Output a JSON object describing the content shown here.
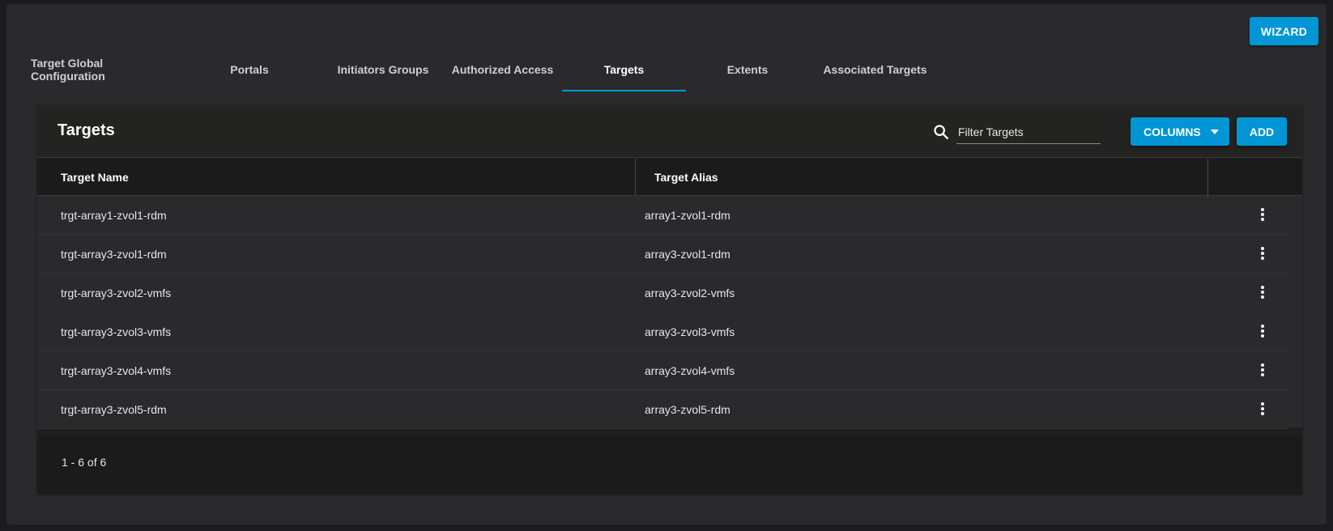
{
  "toolbar": {
    "wizard_label": "WIZARD"
  },
  "tabs": [
    {
      "label": "Target Global Configuration",
      "active": false
    },
    {
      "label": "Portals",
      "active": false
    },
    {
      "label": "Initiators Groups",
      "active": false
    },
    {
      "label": "Authorized Access",
      "active": false
    },
    {
      "label": "Targets",
      "active": true
    },
    {
      "label": "Extents",
      "active": false
    },
    {
      "label": "Associated Targets",
      "active": false
    }
  ],
  "card": {
    "title": "Targets",
    "search_icon": "search-icon",
    "filter_placeholder": "Filter Targets",
    "filter_value": "",
    "columns_label": "COLUMNS",
    "add_label": "ADD"
  },
  "table": {
    "headers": [
      "Target Name",
      "Target Alias"
    ],
    "rows": [
      {
        "name": "trgt-array1-zvol1-rdm",
        "alias": "array1-zvol1-rdm"
      },
      {
        "name": "trgt-array3-zvol1-rdm",
        "alias": "array3-zvol1-rdm"
      },
      {
        "name": "trgt-array3-zvol2-vmfs",
        "alias": "array3-zvol2-vmfs"
      },
      {
        "name": "trgt-array3-zvol3-vmfs",
        "alias": "array3-zvol3-vmfs"
      },
      {
        "name": "trgt-array3-zvol4-vmfs",
        "alias": "array3-zvol4-vmfs"
      },
      {
        "name": "trgt-array3-zvol5-rdm",
        "alias": "array3-zvol5-rdm"
      }
    ],
    "row_action_icon": "more-vert-icon"
  },
  "footer": {
    "range": "1 - 6 of 6"
  },
  "colors": {
    "accent": "#0095d5",
    "background": "#2a2a2d",
    "card_header": "#232321",
    "table_header": "#1b1b1c"
  }
}
